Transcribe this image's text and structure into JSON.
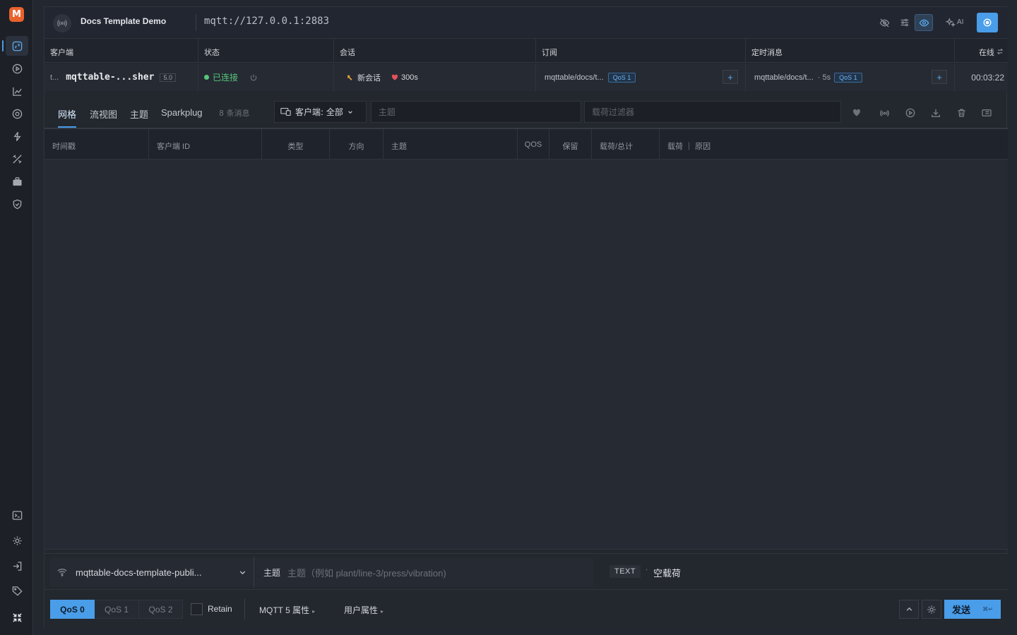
{
  "app": {
    "logo_letter": "M"
  },
  "topbar": {
    "title": "Docs Template Demo",
    "url": "mqtt://127.0.0.1:2883",
    "ai_label": "AI"
  },
  "client_table": {
    "headers": {
      "client": "客户端",
      "status": "状态",
      "session": "会话",
      "subscriptions": "订阅",
      "scheduled": "定时消息",
      "online": "在线"
    },
    "row": {
      "client_prefix": "t...",
      "client_name": "mqttable-...sher",
      "version": "5.0",
      "status": "已连接",
      "session_new": "新会话",
      "session_expiry": "300s",
      "subscription_topic": "mqttable/docs/t...",
      "subscription_qos": "QoS 1",
      "scheduled_topic": "mqttable/docs/t...",
      "scheduled_interval": "· 5s",
      "scheduled_qos": "QoS 1",
      "online_time": "00:03:22"
    },
    "plus": "+"
  },
  "tabs": {
    "grid": "网格",
    "flow": "流视图",
    "topic": "主题",
    "sparkplug": "Sparkplug",
    "message_count": "8 条消息"
  },
  "filters": {
    "client_filter": "客户端: 全部",
    "topic_placeholder": "主题",
    "payload_placeholder": "载荷过滤器"
  },
  "message_grid": {
    "columns": [
      "时间戳",
      "客户端 ID",
      "类型",
      "方向",
      "主题",
      "QOS",
      "保留",
      "载荷/总计",
      "载荷 ｜ 原因"
    ]
  },
  "publish": {
    "client": "mqttable-docs-template-publi...",
    "topic_label": "主题",
    "topic_placeholder": "主题（例如 plant/line-3/press/vibration)",
    "payload_type": "TEXT",
    "payload_sep": "·",
    "payload_empty": "空载荷",
    "qos_options": [
      "QoS 0",
      "QoS 1",
      "QoS 2"
    ],
    "qos_selected": "QoS 0",
    "retain": "Retain",
    "mqtt5_props": "MQTT 5 属性",
    "user_props": "用户属性",
    "send": "发送",
    "send_shortcut": "⌘↵"
  },
  "colors": {
    "accent": "#4a9de8",
    "connected": "#56c77a",
    "brand": "#e8622c"
  }
}
